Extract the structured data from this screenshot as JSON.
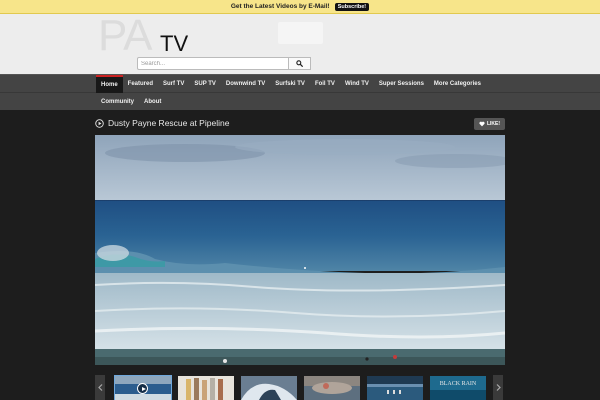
{
  "banner": {
    "text": "Get the Latest Videos by E-Mail!",
    "subscribe_label": "Subscribe!"
  },
  "header": {
    "logo_pa": "PA",
    "logo_tv": "TV",
    "search_placeholder": "Search..."
  },
  "nav": {
    "items": [
      {
        "label": "Home",
        "active": true
      },
      {
        "label": "Featured"
      },
      {
        "label": "Surf TV"
      },
      {
        "label": "SUP TV"
      },
      {
        "label": "Downwind TV"
      },
      {
        "label": "Surfski TV"
      },
      {
        "label": "Foil TV"
      },
      {
        "label": "Wind TV"
      },
      {
        "label": "Super Sessions"
      },
      {
        "label": "More Categories"
      }
    ],
    "items_row2": [
      {
        "label": "Community"
      },
      {
        "label": "About"
      }
    ]
  },
  "video": {
    "title": "Dusty Payne Rescue at Pipeline",
    "like_label": "LIKE!"
  },
  "thumbnails": [
    {
      "icon": "play-icon"
    },
    {
      "icon": "none"
    },
    {
      "icon": "none"
    },
    {
      "icon": "none"
    },
    {
      "icon": "none"
    },
    {
      "icon": "none",
      "caption": "BLACK RAIN"
    }
  ],
  "colors": {
    "banner_bg": "#f7e58a",
    "nav_bg": "#444444",
    "nav_active_accent": "#cc2222",
    "page_bg": "#1d1d1d"
  }
}
